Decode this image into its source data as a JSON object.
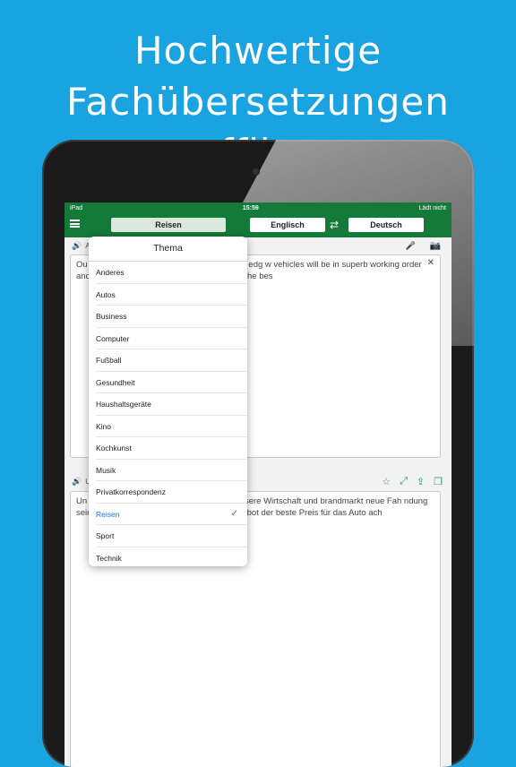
{
  "headline": {
    "line1": "Hochwertige",
    "line2": "Fachübersetzungen offline"
  },
  "status": {
    "device": "iPad",
    "time": "15:59",
    "charging": "Lädt nicht"
  },
  "nav": {
    "topic_button": "Reisen",
    "source_lang": "Englisch",
    "target_lang": "Deutsch",
    "swap_icon": "swap-arrows"
  },
  "source_panel": {
    "lang_label": "A",
    "text": "Ou helpful and friendly. We guarantee cutting edg w vehicles will be in superb working order and ch the car rental market, looking to offer the bes"
  },
  "target_panel": {
    "lang_label": "U",
    "text": "Un erfahren, nützlich und freundlich. Wir ver sere Wirtschaft und brandmarkt neue Fah ndung sein und fleckenlos reinigen. Wir erfe uf Angebot der beste Preis für das Auto ach"
  },
  "dropdown": {
    "title": "Thema",
    "items": [
      "Anderes",
      "Autos",
      "Business",
      "Computer",
      "Fußball",
      "Gesundheit",
      "Haushaltsgeräte",
      "Kino",
      "Kochkunst",
      "Musik",
      "Privatkorrespondenz",
      "Reisen",
      "Sport",
      "Technik"
    ],
    "selected": "Reisen"
  },
  "colors": {
    "background": "#19a3e0",
    "brand_green": "#147a3a",
    "selected_blue": "#2a6fd6"
  }
}
